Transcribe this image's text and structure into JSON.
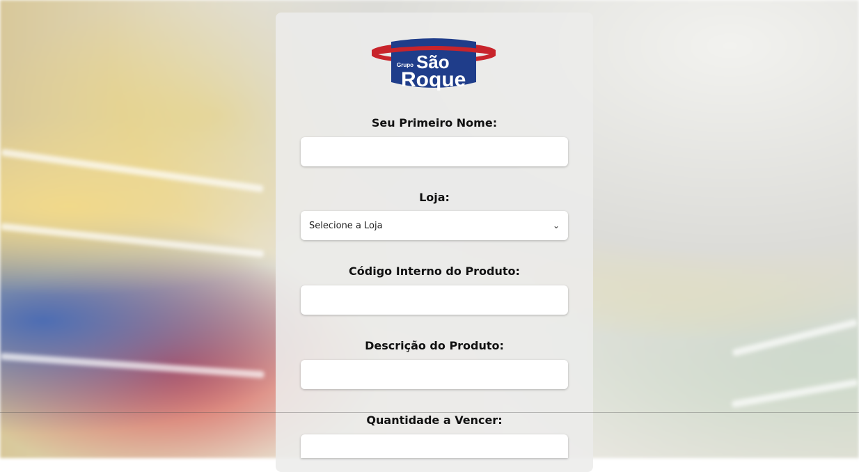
{
  "logo": {
    "prefix": "Grupo",
    "line1": "São",
    "line2": "Roque",
    "colors": {
      "blue": "#1f3d8a",
      "red": "#c8242b",
      "white": "#ffffff"
    }
  },
  "form": {
    "first_name": {
      "label": "Seu Primeiro Nome:",
      "value": ""
    },
    "store": {
      "label": "Loja:",
      "selected": "Selecione a Loja",
      "icon": "chevron-down-icon"
    },
    "product_code": {
      "label": "Código Interno do Produto:",
      "value": ""
    },
    "product_description": {
      "label": "Descrição do Produto:",
      "value": ""
    },
    "quantity": {
      "label": "Quantidade a Vencer:",
      "value": ""
    }
  }
}
